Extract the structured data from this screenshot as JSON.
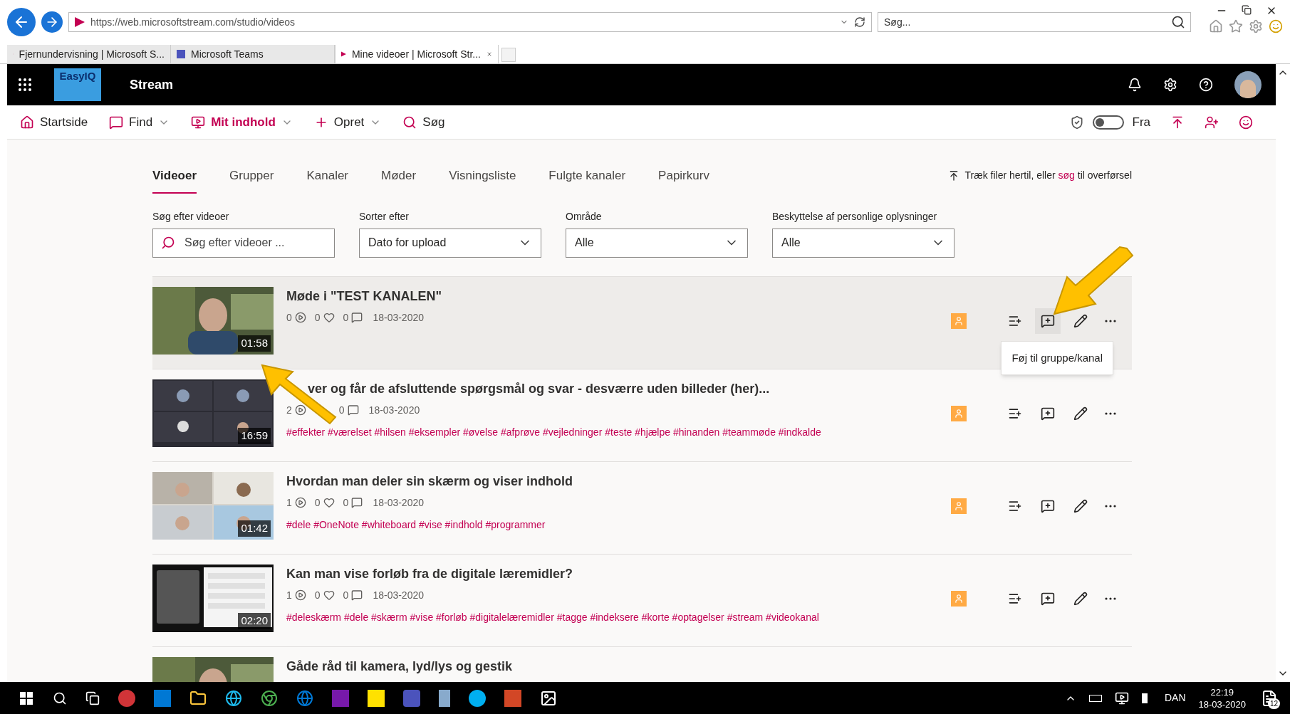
{
  "browser": {
    "url": "https://web.microsoftstream.com/studio/videos",
    "search_placeholder": "Søg...",
    "tabs": [
      {
        "title": "Fjernundervisning | Microsoft S...",
        "selected": false
      },
      {
        "title": "Microsoft Teams",
        "selected": false
      },
      {
        "title": "Mine videoer | Microsoft Str...",
        "selected": true
      }
    ]
  },
  "header": {
    "logo": "EasyIQ",
    "title": "Stream"
  },
  "nav": {
    "items": [
      {
        "label": "Startside",
        "kind": "home",
        "caret": false,
        "selected": false
      },
      {
        "label": "Find",
        "kind": "find",
        "caret": true,
        "selected": false
      },
      {
        "label": "Mit indhold",
        "kind": "content",
        "caret": true,
        "selected": true
      },
      {
        "label": "Opret",
        "kind": "create",
        "caret": true,
        "selected": false
      },
      {
        "label": "Søg",
        "kind": "search",
        "caret": false,
        "selected": false
      }
    ],
    "toggle": {
      "on": false,
      "label": "Fra"
    }
  },
  "tabs": [
    {
      "label": "Videoer",
      "selected": true
    },
    {
      "label": "Grupper",
      "selected": false
    },
    {
      "label": "Kanaler",
      "selected": false
    },
    {
      "label": "Møder",
      "selected": false
    },
    {
      "label": "Visningsliste",
      "selected": false
    },
    {
      "label": "Fulgte kanaler",
      "selected": false
    },
    {
      "label": "Papirkurv",
      "selected": false
    }
  ],
  "upload_hint": {
    "before": "Træk filer hertil, eller",
    "link": "søg",
    "after": "til overførsel"
  },
  "filters": [
    {
      "label": "Søg efter videoer",
      "kind": "search",
      "placeholder": "Søg efter videoer ..."
    },
    {
      "label": "Sorter efter",
      "kind": "select",
      "value": "Dato for upload"
    },
    {
      "label": "Område",
      "kind": "select",
      "value": "Alle"
    },
    {
      "label": "Beskyttelse af personlige oplysninger",
      "kind": "select",
      "value": "Alle"
    }
  ],
  "videos": [
    {
      "title": "Møde i \"TEST KANALEN\"",
      "views": "0",
      "likes": "0",
      "comments": "0",
      "date": "18-03-2020",
      "duration": "01:58",
      "highlighted": true,
      "tooltip": "Føj til gruppe/kanal"
    },
    {
      "title": "ver og får de afsluttende spørgsmål og svar - desværre uden billeder (her)...",
      "views": "2",
      "comments": "0",
      "date": "18-03-2020",
      "duration": "16:59",
      "tags": "#effekter #værelset #hilsen #eksempler #øvelse #afprøve #vejledninger #teste #hjælpe #hinanden #teammøde #indkalde",
      "highlighted": false
    },
    {
      "title": "Hvordan man deler sin skærm og viser indhold",
      "views": "1",
      "likes": "0",
      "comments": "0",
      "date": "18-03-2020",
      "duration": "01:42",
      "tags": "#dele #OneNote #whiteboard #vise #indhold #programmer",
      "highlighted": false
    },
    {
      "title": "Kan man vise forløb fra de digitale læremidler?",
      "views": "1",
      "likes": "0",
      "comments": "0",
      "date": "18-03-2020",
      "duration": "02:20",
      "tags": "#deleskærm #dele #skærm #vise #forløb #digitalelæremidler #tagge #indeksere #korte #optagelser #stream #videokanal",
      "highlighted": false
    },
    {
      "title": "Gåde råd til kamera, lyd/lys og gestik",
      "highlighted": false
    }
  ],
  "taskbar": {
    "language": "DAN",
    "time": "22:19",
    "date": "18-03-2020",
    "notifications": "12"
  }
}
